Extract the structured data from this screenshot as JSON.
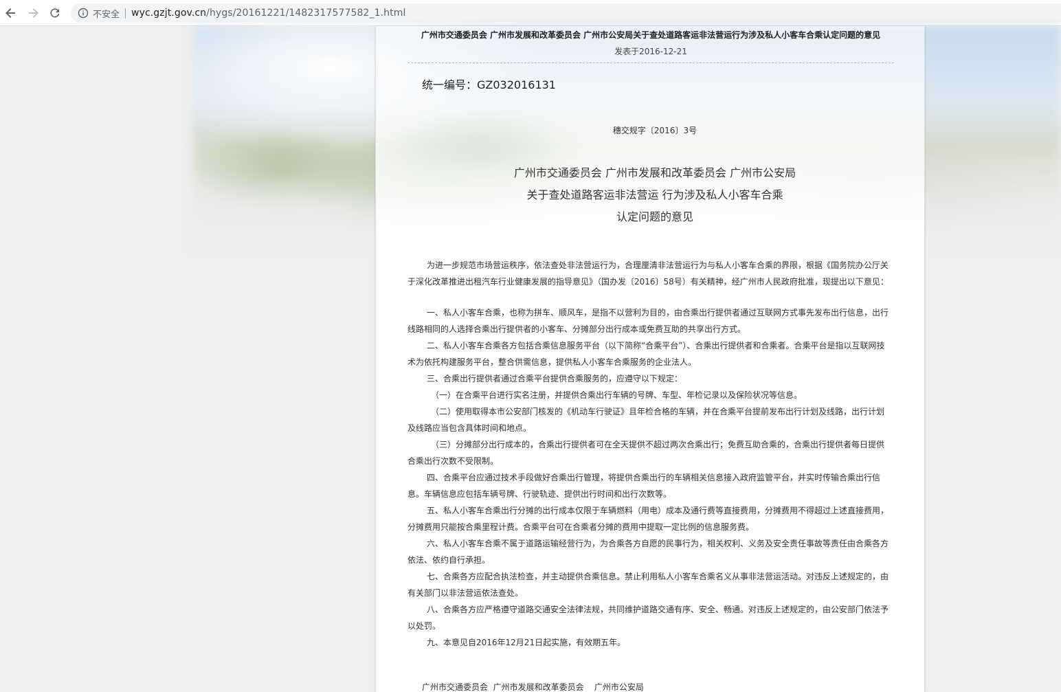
{
  "browser": {
    "insecure_label": "不安全",
    "url_host": "wyc.gzjt.gov.cn",
    "url_path": "/hygs/20161221/1482317577582_1.html"
  },
  "doc": {
    "header_title": "广州市交通委员会 广州市发展和改革委员会 广州市公安局关于查处道路客运非法营运行为涉及私人小客车合乘认定问题的意见",
    "date": "发表于2016-12-21",
    "serial": "统一编号：GZ032016131",
    "doc_no": "穗交规字〔2016〕3号",
    "title_lines": [
      "广州市交通委员会 广州市发展和改革委员会 广州市公安局",
      "关于查处道路客运非法营运 行为涉及私人小客车合乘",
      "认定问题的意见"
    ],
    "paragraphs": [
      "为进一步规范市场营运秩序，依法查处非法营运行为，合理厘清非法营运行为与私人小客车合乘的界限，根据《国务院办公厅关于深化改革推进出租汽车行业健康发展的指导意见》（国办发〔2016〕58号）有关精神，经广州市人民政府批准，现提出以下意见：",
      "",
      "一、私人小客车合乘，也称为拼车、顺风车，是指不以营利为目的，由合乘出行提供者通过互联网方式事先发布出行信息，出行线路相同的人选择合乘出行提供者的小客车、分摊部分出行成本或免费互助的共享出行方式。",
      "二、私人小客车合乘各方包括合乘信息服务平台（以下简称“合乘平台”）、合乘出行提供者和合乘者。合乘平台是指以互联网技术为依托构建服务平台，整合供需信息，提供私人小客车合乘服务的企业法人。",
      "三、合乘出行提供者通过合乘平台提供合乘服务的，应遵守以下规定：",
      "（一）在合乘平台进行实名注册，并提供合乘出行车辆的号牌、车型、年检记录以及保险状况等信息。",
      "（二）使用取得本市公安部门核发的《机动车行驶证》且年检合格的车辆，并在合乘平台提前发布出行计划及线路，出行计划及线路应当包含具体时间和地点。",
      "（三）分摊部分出行成本的，合乘出行提供者可在全天提供不超过两次合乘出行；免费互助合乘的，合乘出行提供者每日提供合乘出行次数不受限制。",
      "四、合乘平台应通过技术手段做好合乘出行管理，将提供合乘出行的车辆相关信息接入政府监管平台，并实时传输合乘出行信息。车辆信息应包括车辆号牌、行驶轨迹、提供出行时间和出行次数等。",
      "五、私人小客车合乘出行分摊的出行成本仅限于车辆燃料（用电）成本及通行费等直接费用，分摊费用不得超过上述直接费用，分摊费用只能按合乘里程计费。合乘平台可在合乘者分摊的费用中提取一定比例的信息服务费。",
      "六、私人小客车合乘不属于道路运输经营行为，为合乘各方自愿的民事行为，相关权利、义务及安全责任事故等责任由合乘各方依法、依约自行承担。",
      "七、合乘各方应配合执法检查，并主动提供合乘信息。禁止利用私人小客车合乘名义从事非法营运活动。对违反上述规定的，由有关部门以非法营运依法查处。",
      "八、合乘各方应严格遵守道路交通安全法律法规，共同维护道路交通有序、安全、畅通。对违反上述规定的，由公安部门依法予以处罚。",
      "九、本意见自2016年12月21日起实施，有效期五年。"
    ],
    "signature": "广州市交通委员会  广州市发展和改革委员会    广州市公安局"
  }
}
